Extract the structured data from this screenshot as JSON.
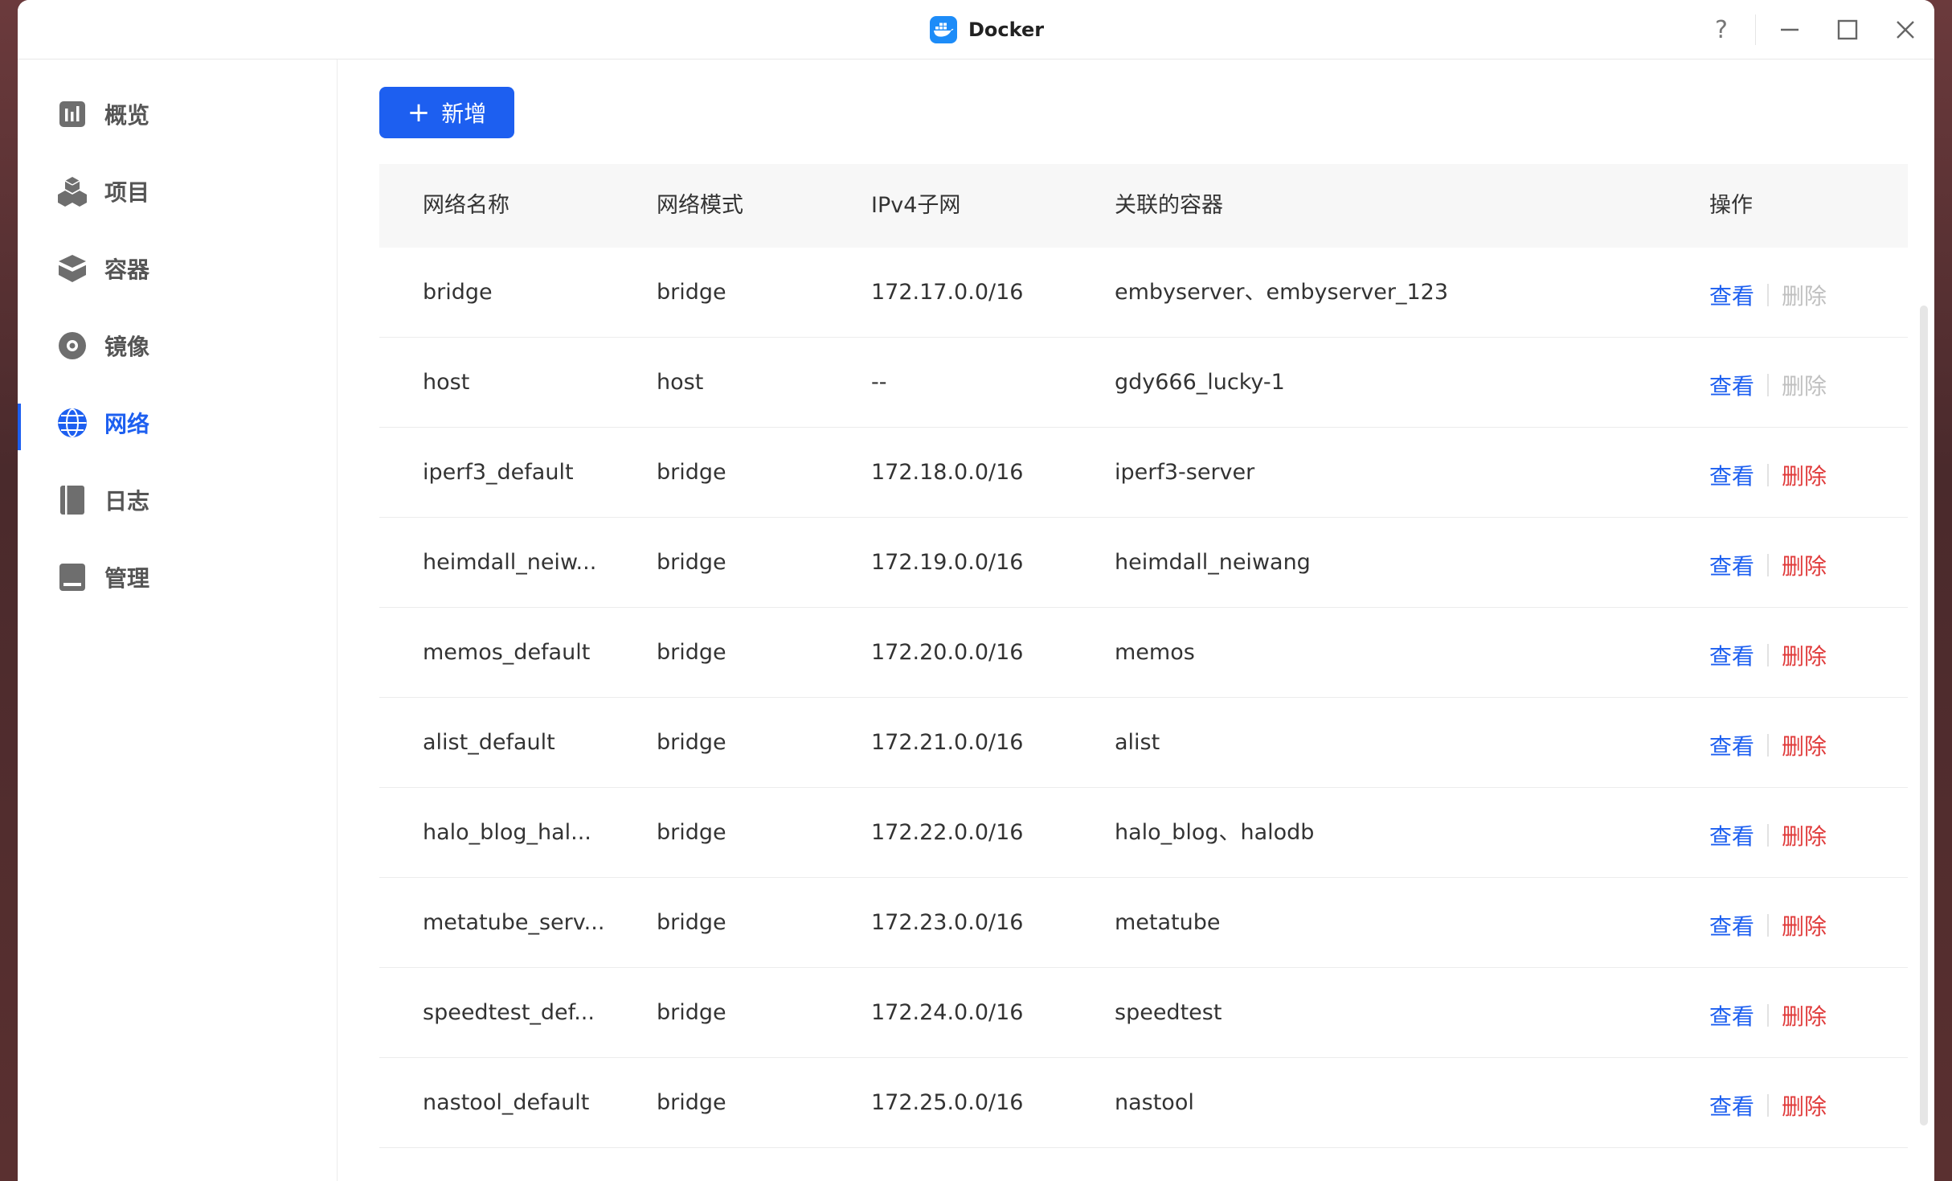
{
  "window": {
    "title": "Docker",
    "controls": [
      "help-icon",
      "minimize-icon",
      "maximize-icon",
      "close-icon"
    ],
    "help_label": "?"
  },
  "sidebar": {
    "items": [
      {
        "label": "概览",
        "icon": "chart-icon",
        "active": false
      },
      {
        "label": "项目",
        "icon": "cubes-icon",
        "active": false
      },
      {
        "label": "容器",
        "icon": "layers-icon",
        "active": false
      },
      {
        "label": "镜像",
        "icon": "disc-icon",
        "active": false
      },
      {
        "label": "网络",
        "icon": "globe-icon",
        "active": true
      },
      {
        "label": "日志",
        "icon": "book-icon",
        "active": false
      },
      {
        "label": "管理",
        "icon": "drive-icon",
        "active": false
      }
    ]
  },
  "toolbar": {
    "add_label": "新增",
    "add_icon": "plus-icon",
    "plus": "+"
  },
  "table": {
    "headers": [
      "网络名称",
      "网络模式",
      "IPv4子网",
      "关联的容器",
      "操作"
    ],
    "view_label": "查看",
    "delete_label": "删除",
    "rows": [
      {
        "name": "bridge",
        "mode": "bridge",
        "subnet": "172.17.0.0/16",
        "containers": "embyserver、embyserver_123",
        "deletable": false
      },
      {
        "name": "host",
        "mode": "host",
        "subnet": "--",
        "containers": "gdy666_lucky-1",
        "deletable": false
      },
      {
        "name": "iperf3_default",
        "mode": "bridge",
        "subnet": "172.18.0.0/16",
        "containers": "iperf3-server",
        "deletable": true
      },
      {
        "name": "heimdall_neiw...",
        "mode": "bridge",
        "subnet": "172.19.0.0/16",
        "containers": "heimdall_neiwang",
        "deletable": true
      },
      {
        "name": "memos_default",
        "mode": "bridge",
        "subnet": "172.20.0.0/16",
        "containers": "memos",
        "deletable": true
      },
      {
        "name": "alist_default",
        "mode": "bridge",
        "subnet": "172.21.0.0/16",
        "containers": "alist",
        "deletable": true
      },
      {
        "name": "halo_blog_hal...",
        "mode": "bridge",
        "subnet": "172.22.0.0/16",
        "containers": "halo_blog、halodb",
        "deletable": true
      },
      {
        "name": "metatube_serv...",
        "mode": "bridge",
        "subnet": "172.23.0.0/16",
        "containers": "metatube",
        "deletable": true
      },
      {
        "name": "speedtest_def...",
        "mode": "bridge",
        "subnet": "172.24.0.0/16",
        "containers": "speedtest",
        "deletable": true
      },
      {
        "name": "nastool_default",
        "mode": "bridge",
        "subnet": "172.25.0.0/16",
        "containers": "nastool",
        "deletable": true
      }
    ]
  },
  "colors": {
    "accent": "#1d5ff0",
    "danger": "#e03b3b",
    "disabled": "#c0c0c0"
  }
}
